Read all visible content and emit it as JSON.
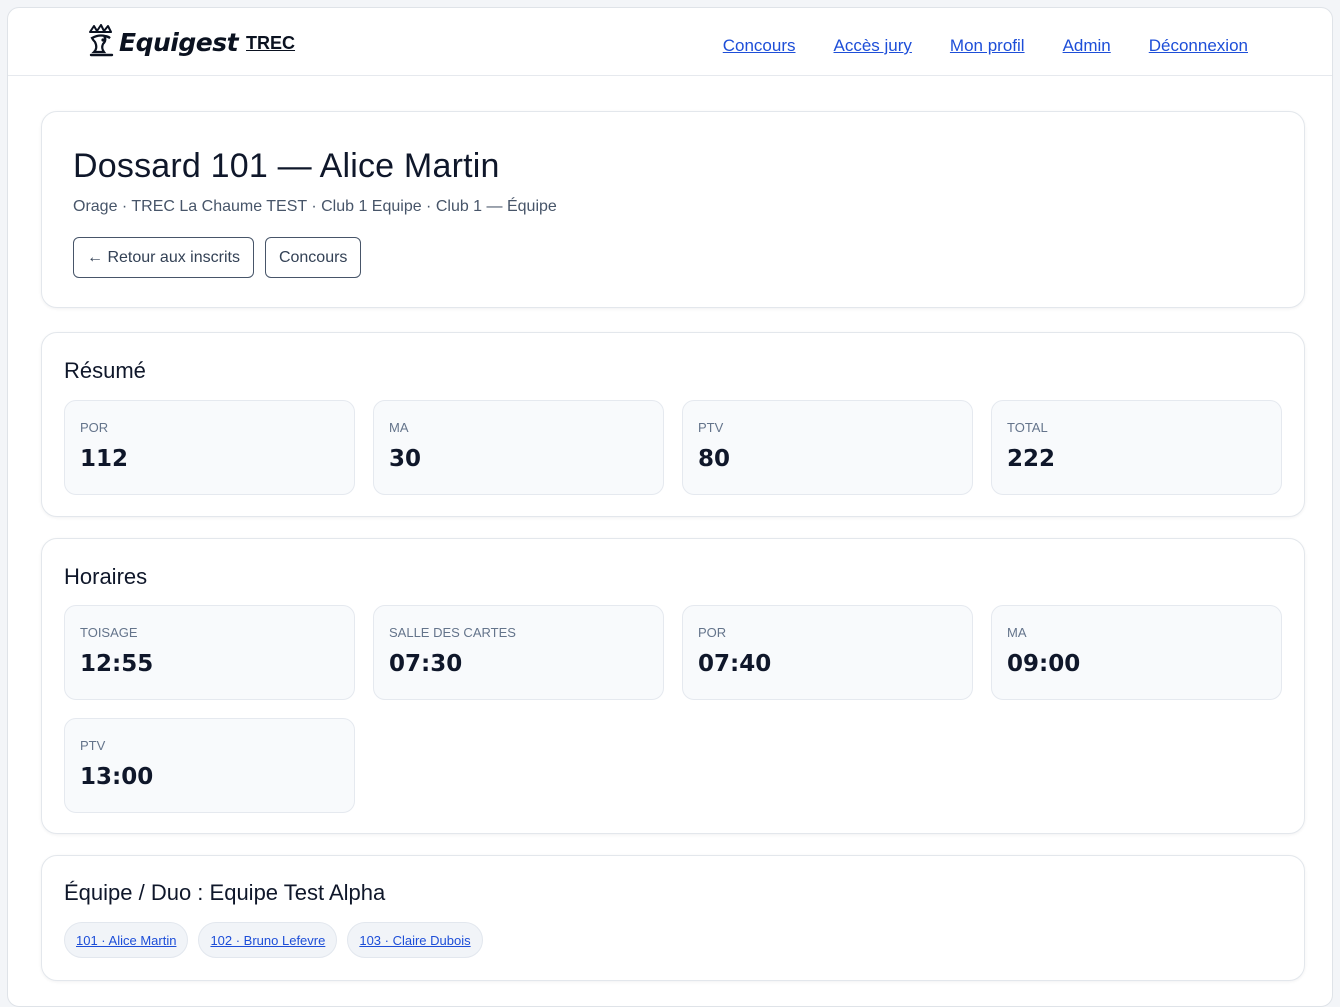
{
  "header": {
    "brand": "Equigest",
    "brand_tag": "TREC",
    "nav": [
      "Concours",
      "Accès jury",
      "Mon profil",
      "Admin",
      "Déconnexion"
    ]
  },
  "rider": {
    "title": "Dossard 101 — Alice Martin",
    "subtitle": "Orage · TREC La Chaume TEST · Club 1 Equipe · Club 1 — Équipe",
    "back_label": "← Retour aux inscrits",
    "concours_label": "Concours"
  },
  "resume": {
    "title": "Résumé",
    "items": [
      {
        "label": "POR",
        "value": "112"
      },
      {
        "label": "MA",
        "value": "30"
      },
      {
        "label": "PTV",
        "value": "80"
      },
      {
        "label": "TOTAL",
        "value": "222"
      }
    ]
  },
  "horaires": {
    "title": "Horaires",
    "items": [
      {
        "label": "TOISAGE",
        "value": "12:55"
      },
      {
        "label": "SALLE DES CARTES",
        "value": "07:30"
      },
      {
        "label": "POR",
        "value": "07:40"
      },
      {
        "label": "MA",
        "value": "09:00"
      },
      {
        "label": "PTV",
        "value": "13:00"
      }
    ]
  },
  "team": {
    "title": "Équipe / Duo : Equipe Test Alpha",
    "members": [
      "101 · Alice Martin",
      "102 · Bruno Lefevre",
      "103 · Claire Dubois"
    ]
  },
  "colors": {
    "link": "#1d4ed8",
    "text": "#0f172a",
    "muted": "#64748b"
  }
}
